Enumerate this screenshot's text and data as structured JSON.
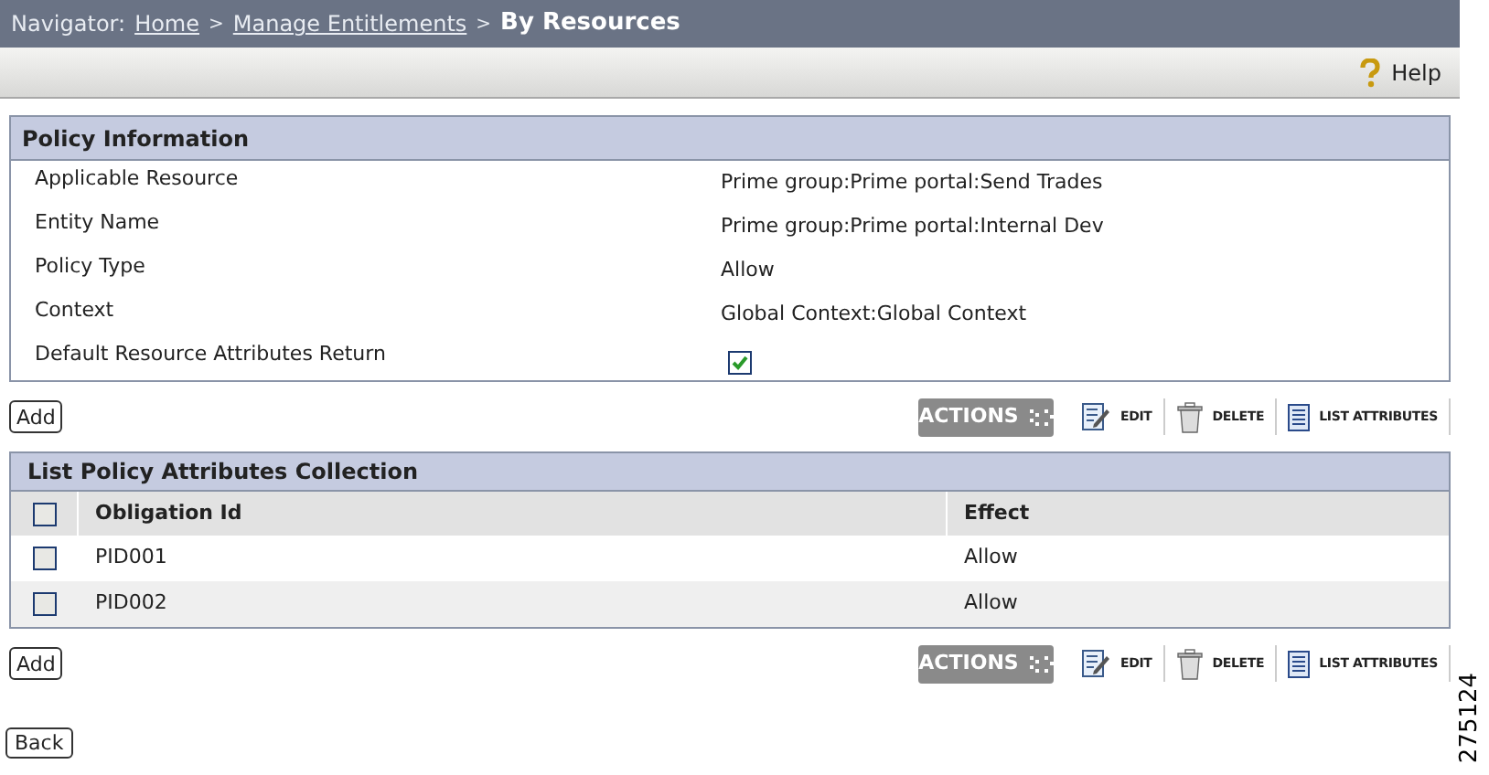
{
  "navigator": {
    "label": "Navigator:",
    "links": [
      "Home",
      "Manage Entitlements"
    ],
    "separators": [
      ">",
      ">"
    ],
    "current": "By Resources"
  },
  "toolbar": {
    "help": "Help"
  },
  "policy_information": {
    "title": "Policy Information",
    "fields": [
      {
        "kind": "text",
        "label": "Applicable Resource",
        "value": "Prime group:Prime portal:Send Trades"
      },
      {
        "kind": "text",
        "label": "Entity Name",
        "value": "Prime group:Prime portal:Internal Dev"
      },
      {
        "kind": "text",
        "label": "Policy Type",
        "value": "Allow"
      },
      {
        "kind": "text",
        "label": "Context",
        "value": "Global Context:Global Context"
      },
      {
        "kind": "checkbox",
        "label": "Default Resource Attributes Return",
        "checked": true
      }
    ]
  },
  "action_bars": [
    {
      "add": "Add",
      "actions": "ACTIONS",
      "tools": [
        "EDIT",
        "DELETE",
        "LIST ATTRIBUTES"
      ]
    },
    {
      "add": "Add",
      "actions": "ACTIONS",
      "tools": [
        "EDIT",
        "DELETE",
        "LIST ATTRIBUTES"
      ]
    }
  ],
  "attributes_table": {
    "title": "List Policy Attributes Collection",
    "header_checked": false,
    "columns": [
      "Obligation Id",
      "Effect"
    ],
    "rows": [
      {
        "checked": false,
        "cells": [
          "PID001",
          "Allow"
        ]
      },
      {
        "checked": false,
        "cells": [
          "PID002",
          "Allow"
        ]
      }
    ]
  },
  "back": "Back",
  "figure_number": "275124"
}
